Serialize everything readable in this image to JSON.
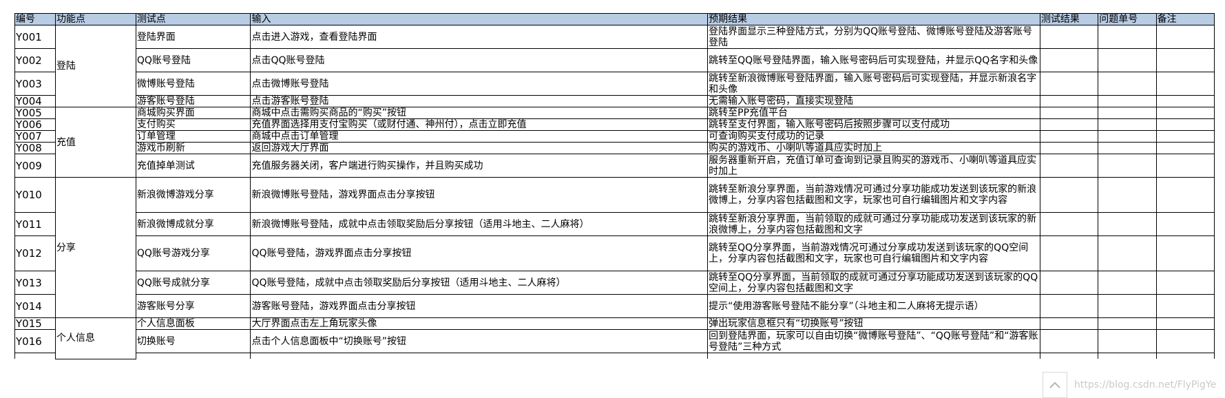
{
  "headers": [
    "编号",
    "功能点",
    "测试点",
    "输入",
    "预期结果",
    "测试结果",
    "问题单号",
    "备注"
  ],
  "rows": [
    {
      "id": "Y001",
      "feature": "登陆",
      "point": "登陆界面",
      "input": "点击进入游戏，查看登陆界面",
      "expected": "登陆界面显示三种登陆方式，分别为QQ账号登陆、微博账号登陆及游客账号登陆"
    },
    {
      "id": "Y002",
      "point": "QQ账号登陆",
      "input": "点击QQ账号登陆",
      "expected": "跳转至QQ账号登陆界面，输入账号密码后可实现登陆，并显示QQ名字和头像"
    },
    {
      "id": "Y003",
      "point": "微博账号登陆",
      "input": "点击微博账号登陆",
      "expected": "跳转至新浪微博账号登陆界面，输入账号密码后可实现登陆，并显示新浪名字和头像"
    },
    {
      "id": "Y004",
      "point": "游客账号登陆",
      "input": "点击游客账号登陆",
      "expected": "无需输入账号密码，直接实现登陆"
    },
    {
      "id": "Y005",
      "feature": "充值",
      "point": "商城购买界面",
      "input": "商城中点击需购买商品的“购买”按钮",
      "expected": "跳转至PP充值平台"
    },
    {
      "id": "Y006",
      "point": "支付购买",
      "input": "充值界面选择用支付宝购买（或财付通、神州付），点击立即充值",
      "expected": "跳转至支付界面，输入账号密码后按照步骤可以支付成功"
    },
    {
      "id": "Y007",
      "point": "订单管理",
      "input": "商城中点击订单管理",
      "expected": "可查询购买支付成功的记录"
    },
    {
      "id": "Y008",
      "point": "游戏币刷新",
      "input": "返回游戏大厅界面",
      "expected": "购买的游戏币、小喇叭等道具应实时加上"
    },
    {
      "id": "Y009",
      "point": "充值掉单测试",
      "input": "充值服务器关闭，客户端进行购买操作，并且购买成功",
      "expected": "服务器重新开启，充值订单可查询到记录且购买的游戏币、小喇叭等道具应实时加上"
    },
    {
      "id": "Y010",
      "feature": "分享",
      "point": "新浪微博游戏分享",
      "input": "新浪微博账号登陆，游戏界面点击分享按钮",
      "expected": "跳转至新浪分享界面，当前游戏情况可通过分享功能成功发送到该玩家的新浪微博上，分享内容包括截图和文字，玩家也可自行编辑图片和文字内容"
    },
    {
      "id": "Y011",
      "point": "新浪微博成就分享",
      "input": "新浪微博账号登陆，成就中点击领取奖励后分享按钮（适用斗地主、二人麻将）",
      "expected": "跳转至新浪分享界面，当前领取的成就可通过分享功能成功发送到该玩家的新浪微博上，分享内容包括截图和文字"
    },
    {
      "id": "Y012",
      "point": "QQ账号游戏分享",
      "input": "QQ账号登陆，游戏界面点击分享按钮",
      "expected": "跳转至QQ分享界面，当前游戏情况可通过分享成功发送到该玩家的QQ空间上，分享内容包括截图和文字，玩家也可自行编辑图片和文字内容"
    },
    {
      "id": "Y013",
      "point": "QQ账号成就分享",
      "input": "QQ账号登陆，成就中点击领取奖励后分享按钮（适用斗地主、二人麻将）",
      "expected": "跳转至QQ分享界面，当前领取的成就可通过分享功能成功发送到该玩家的QQ空间上，分享内容包括截图和文字"
    },
    {
      "id": "Y014",
      "point": "游客账号分享",
      "input": "游客账号登陆，游戏界面点击分享按钮",
      "expected": "提示“使用游客账号登陆不能分享”（斗地主和二人麻将无提示语）"
    },
    {
      "id": "Y015",
      "feature": "个人信息",
      "point": "个人信息面板",
      "input": "大厅界面点击左上角玩家头像",
      "expected": "弹出玩家信息框只有“切换账号”按钮"
    },
    {
      "id": "Y016",
      "point": "切换账号",
      "input": "点击个人信息面板中“切换账号”按钮",
      "expected": "回到登陆界面，玩家可以自由切换“微博账号登陆”、“QQ账号登陆”和“游客账号登陆”三种方式"
    }
  ],
  "watermark": "https://blog.csdn.net/FlyPigYe",
  "icons": {
    "scroll_top": "chevron-up-icon"
  }
}
